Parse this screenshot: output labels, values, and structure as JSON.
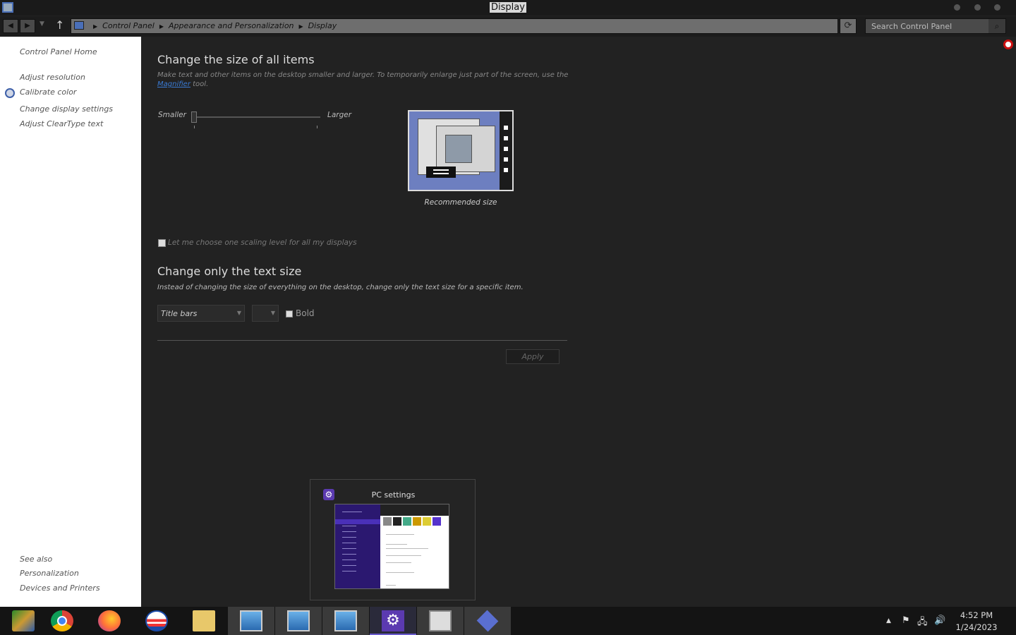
{
  "window": {
    "title": "Display"
  },
  "address_bar": {
    "breadcrumbs": [
      "Control Panel",
      "Appearance and Personalization",
      "Display"
    ],
    "search_placeholder": "Search Control Panel"
  },
  "sidebar": {
    "home": "Control Panel Home",
    "items": [
      {
        "label": "Adjust resolution"
      },
      {
        "label": "Calibrate color"
      },
      {
        "label": "Change display settings"
      },
      {
        "label": "Adjust ClearType text"
      }
    ],
    "see_also": {
      "heading": "See also",
      "links": [
        "Personalization",
        "Devices and Printers"
      ]
    }
  },
  "main": {
    "section1": {
      "heading": "Change the size of all items",
      "description_line1": "Make text and other items on the desktop smaller and larger. To temporarily enlarge just part of the screen, use the",
      "link": "Magnifier",
      "description_end": "tool.",
      "slider": {
        "min_label": "Smaller",
        "max_label": "Larger",
        "value_fraction": 0.0
      },
      "preview_caption": "Recommended size",
      "checkbox_label": "Let me choose one scaling level for all my displays",
      "checkbox_checked": false
    },
    "section2": {
      "heading": "Change only the text size",
      "description": "Instead of changing the size of everything on the desktop, change only the text size for a specific item.",
      "item_select_value": "Title bars",
      "size_select_value": "",
      "bold_label": "Bold",
      "bold_checked": false
    },
    "apply_label": "Apply"
  },
  "thumbnail": {
    "title": "PC settings"
  },
  "taskbar": {
    "apps": [
      {
        "name": "control-panel-icon"
      },
      {
        "name": "chrome-icon"
      },
      {
        "name": "firefox-icon"
      },
      {
        "name": "obama-campaign-icon"
      },
      {
        "name": "file-explorer-icon"
      },
      {
        "name": "remote-desktop-icon"
      },
      {
        "name": "remote-desktop-icon"
      },
      {
        "name": "remote-desktop-icon"
      },
      {
        "name": "pc-settings-icon"
      },
      {
        "name": "store-icon"
      },
      {
        "name": "diamond-app-icon"
      }
    ],
    "clock": {
      "time": "4:52 PM",
      "date": "1/24/2023"
    }
  },
  "colors": {
    "accent": "#5b3ab0",
    "link": "#3a7bd5",
    "background": "#222222",
    "sidebar": "#ffffff"
  }
}
